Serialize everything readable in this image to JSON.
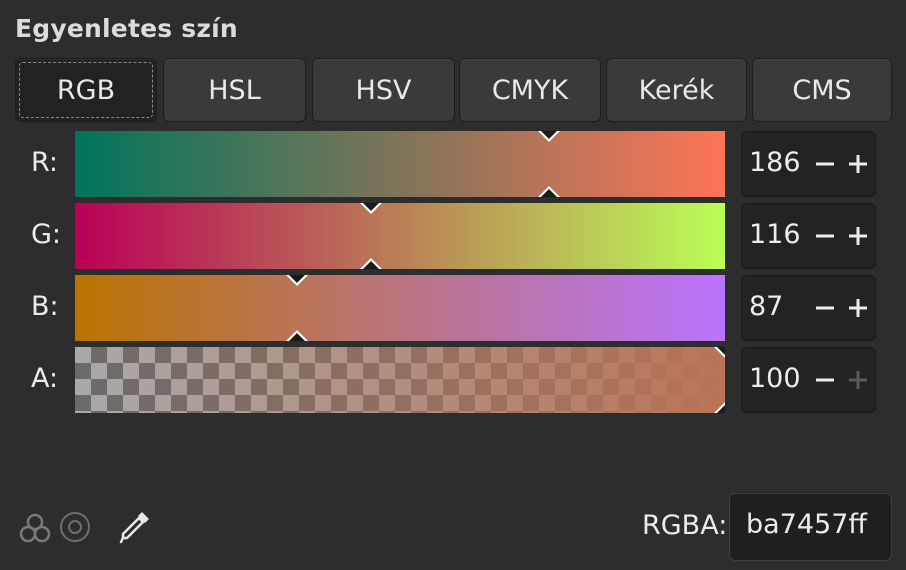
{
  "title": "Egyenletes szín",
  "tabs": [
    {
      "label": "RGB",
      "active": true
    },
    {
      "label": "HSL",
      "active": false
    },
    {
      "label": "HSV",
      "active": false
    },
    {
      "label": "CMYK",
      "active": false
    },
    {
      "label": "Kerék",
      "active": false
    },
    {
      "label": "CMS",
      "active": false
    }
  ],
  "channels": {
    "r": {
      "label": "R:",
      "value": "186",
      "fraction": 0.729,
      "gradient": [
        "#00755b",
        "#ff7457"
      ]
    },
    "g": {
      "label": "G:",
      "value": "116",
      "fraction": 0.455,
      "gradient": [
        "#ba0057",
        "#baff57"
      ]
    },
    "b": {
      "label": "B:",
      "value": "87",
      "fraction": 0.341,
      "gradient": [
        "#ba7400",
        "#ba74ff"
      ]
    },
    "a": {
      "label": "A:",
      "value": "100",
      "fraction": 1.0,
      "gradient": [
        "#ba745700",
        "#ba7457ff"
      ]
    }
  },
  "spin": {
    "minus": "−",
    "plus": "+"
  },
  "icons": {
    "color_mode": "color-circles-icon",
    "color_wheel": "target-circle-icon",
    "picker": "eyedropper-icon"
  },
  "hex": {
    "label": "RGBA:",
    "value": "ba7457ff"
  },
  "colors": {
    "background": "#2d2d2d",
    "current_color": "#ba7457"
  }
}
